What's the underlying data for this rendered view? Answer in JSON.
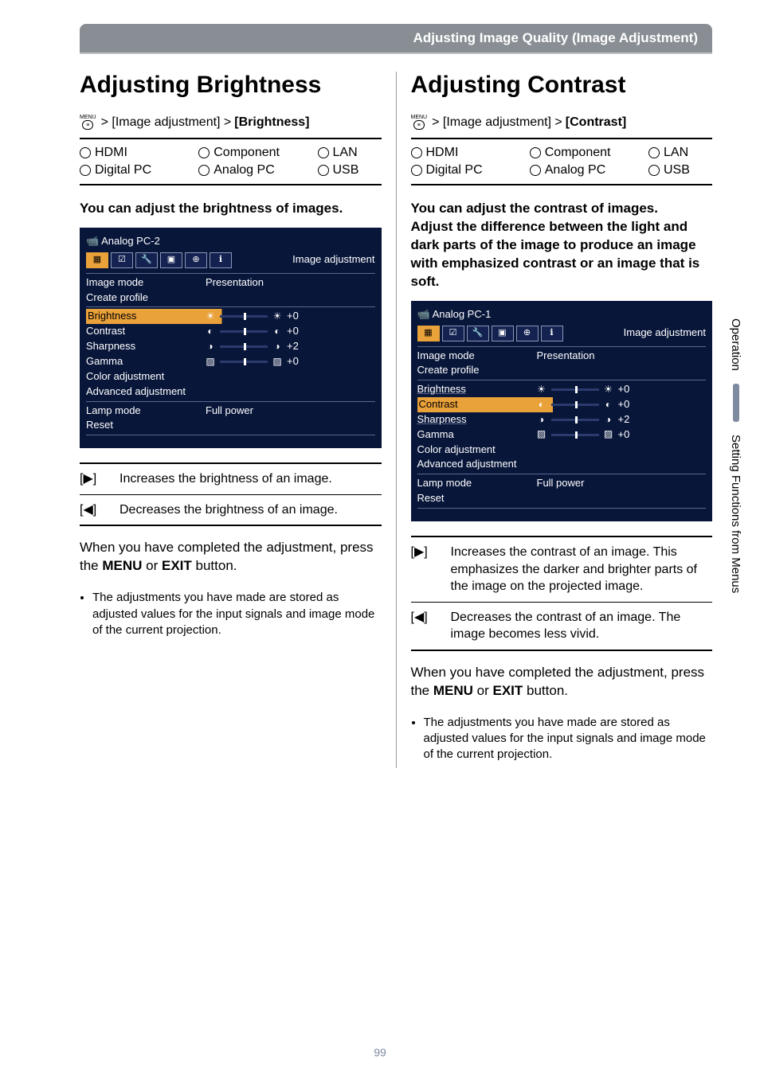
{
  "banner": "Adjusting Image Quality (Image Adjustment)",
  "side": {
    "operation": "Operation",
    "setting": "Setting Functions from Menus"
  },
  "pageNumber": "99",
  "menuIcon": {
    "label": "MENU",
    "glyph": "≡"
  },
  "left": {
    "heading": "Adjusting Brightness",
    "crumb_mid": "> [Image adjustment] >",
    "crumb_end": "[Brightness]",
    "inputs": {
      "r1": [
        "HDMI",
        "Component",
        "LAN"
      ],
      "r2": [
        "Digital PC",
        "Analog PC",
        "USB"
      ]
    },
    "intro": "You can adjust the brightness of images.",
    "osd": {
      "title": "Analog PC-2",
      "sectionLabel": "Image adjustment",
      "rows": [
        {
          "label": "Image mode",
          "value": "Presentation"
        },
        {
          "label": "Create profile",
          "value": ""
        },
        {
          "label": "Brightness",
          "sym": "☀",
          "num": "+0",
          "hl": true
        },
        {
          "label": "Contrast",
          "sym": "◐",
          "num": "+0"
        },
        {
          "label": "Sharpness",
          "sym": "◑",
          "num": "+2"
        },
        {
          "label": "Gamma",
          "sym": "▨",
          "num": "+0"
        },
        {
          "label": "Color adjustment",
          "value": ""
        },
        {
          "label": "Advanced adjustment",
          "value": ""
        },
        {
          "label": "Lamp mode",
          "value": "Full power"
        },
        {
          "label": "Reset",
          "value": ""
        }
      ]
    },
    "dir": {
      "rightKey": "[▶]",
      "rightDesc": "Increases the brightness of an image.",
      "leftKey": "[◀]",
      "leftDesc": "Decreases the brightness of an image."
    },
    "closing_pre": "When you have completed the adjustment, press the ",
    "closing_menu": "MENU",
    "closing_or": " or ",
    "closing_exit": "EXIT",
    "closing_post": " button.",
    "bullet": "The adjustments you have made are stored as adjusted values for the input signals and image mode of the current projection."
  },
  "right": {
    "heading": "Adjusting Contrast",
    "crumb_mid": "> [Image adjustment] >",
    "crumb_end": "[Contrast]",
    "inputs": {
      "r1": [
        "HDMI",
        "Component",
        "LAN"
      ],
      "r2": [
        "Digital PC",
        "Analog PC",
        "USB"
      ]
    },
    "intro": "You can adjust the contrast of images.\nAdjust the difference between the light and dark parts of the image to produce an image with emphasized contrast or an image that is soft.",
    "osd": {
      "title": "Analog PC-1",
      "sectionLabel": "Image adjustment",
      "rows": [
        {
          "label": "Image mode",
          "value": "Presentation"
        },
        {
          "label": "Create profile",
          "value": ""
        },
        {
          "label": "Brightness",
          "sym": "☀",
          "num": "+0",
          "underline": true
        },
        {
          "label": "Contrast",
          "sym": "◐",
          "num": "+0",
          "hl": true
        },
        {
          "label": "Sharpness",
          "sym": "◑",
          "num": "+2",
          "underline": true
        },
        {
          "label": "Gamma",
          "sym": "▨",
          "num": "+0"
        },
        {
          "label": "Color adjustment",
          "value": ""
        },
        {
          "label": "Advanced adjustment",
          "value": ""
        },
        {
          "label": "Lamp mode",
          "value": "Full power"
        },
        {
          "label": "Reset",
          "value": ""
        }
      ]
    },
    "dir": {
      "rightKey": "[▶]",
      "rightDesc": "Increases the contrast of an image. This emphasizes the darker and brighter parts of the image on the projected image.",
      "leftKey": "[◀]",
      "leftDesc": "Decreases the contrast of an image. The image becomes less vivid."
    },
    "closing_pre": "When you have completed the adjustment, press the ",
    "closing_menu": "MENU",
    "closing_or": " or ",
    "closing_exit": "EXIT",
    "closing_post": " button.",
    "bullet": "The adjustments you have made are stored as adjusted values for the input signals and image mode of the current projection."
  }
}
